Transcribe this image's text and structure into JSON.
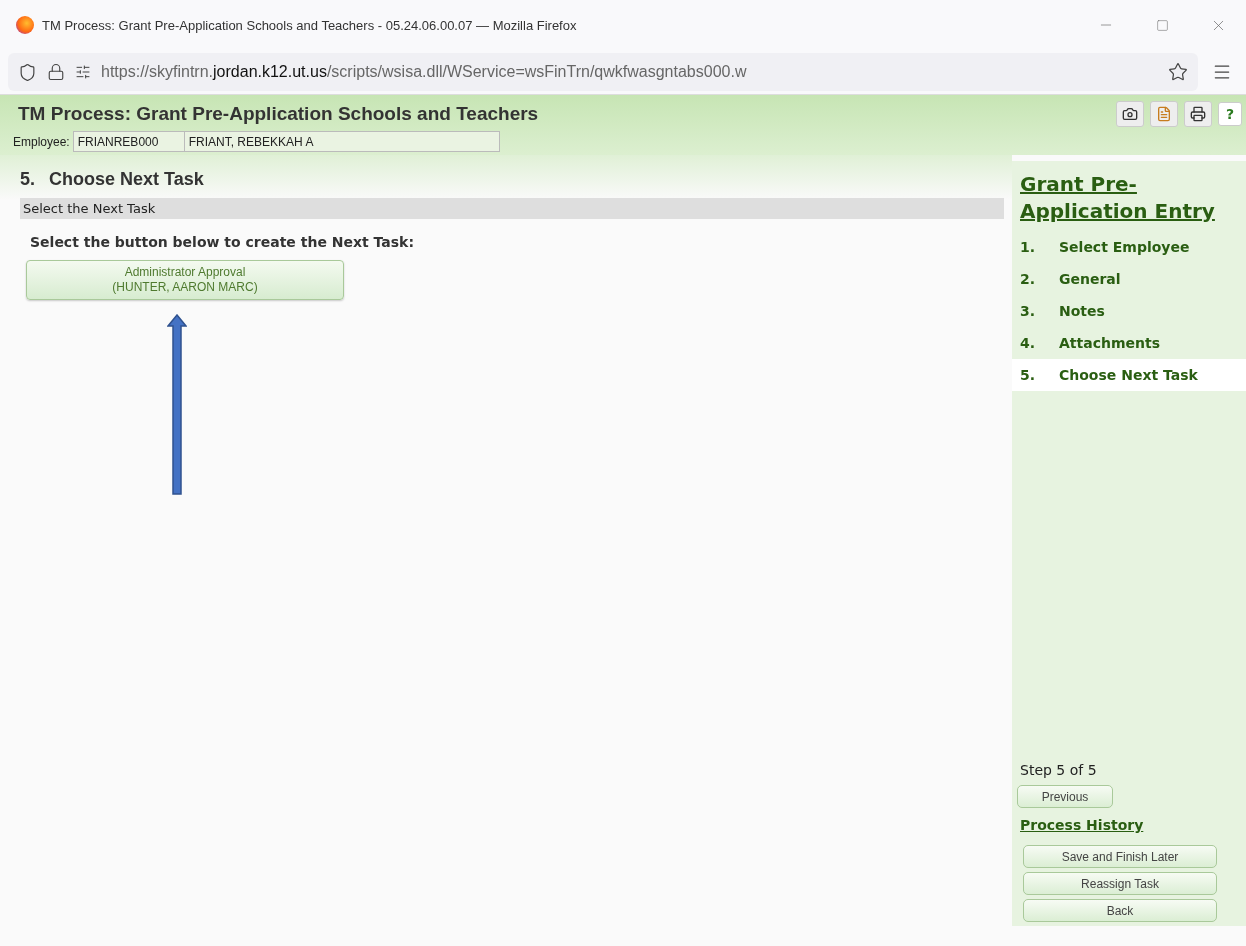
{
  "window": {
    "title": "TM Process: Grant Pre-Application Schools and Teachers - 05.24.06.00.07 — Mozilla Firefox"
  },
  "address_bar": {
    "url_start": "https://skyfintrn.",
    "url_domain": "jordan.k12.ut.us",
    "url_rest": "/scripts/wsisa.dll/WService=wsFinTrn/qwkfwasgntabs000.w"
  },
  "header": {
    "title": "TM Process: Grant Pre-Application Schools and Teachers",
    "employee_label": "Employee:",
    "employee_id": "FRIANREB000",
    "employee_name": "FRIANT, REBEKKAH A",
    "help": "?"
  },
  "step": {
    "number": "5.",
    "title": "Choose Next Task",
    "section": "Select the Next Task",
    "instruction": "Select the button below to create the Next Task:",
    "task_buttons": [
      {
        "line1": "Administrator Approval",
        "line2": "(HUNTER, AARON MARC)"
      }
    ]
  },
  "sidebar": {
    "title": "Grant Pre-Application Entry",
    "steps": [
      {
        "number": "1.",
        "label": "Select Employee",
        "selected": false
      },
      {
        "number": "2.",
        "label": "General",
        "selected": false
      },
      {
        "number": "3.",
        "label": "Notes",
        "selected": false
      },
      {
        "number": "4.",
        "label": "Attachments",
        "selected": false
      },
      {
        "number": "5.",
        "label": "Choose Next Task",
        "selected": true
      }
    ],
    "step_count": "Step 5 of 5",
    "previous": "Previous",
    "process_history": "Process History",
    "actions": [
      "Save and Finish Later",
      "Reassign Task",
      "Back"
    ]
  }
}
